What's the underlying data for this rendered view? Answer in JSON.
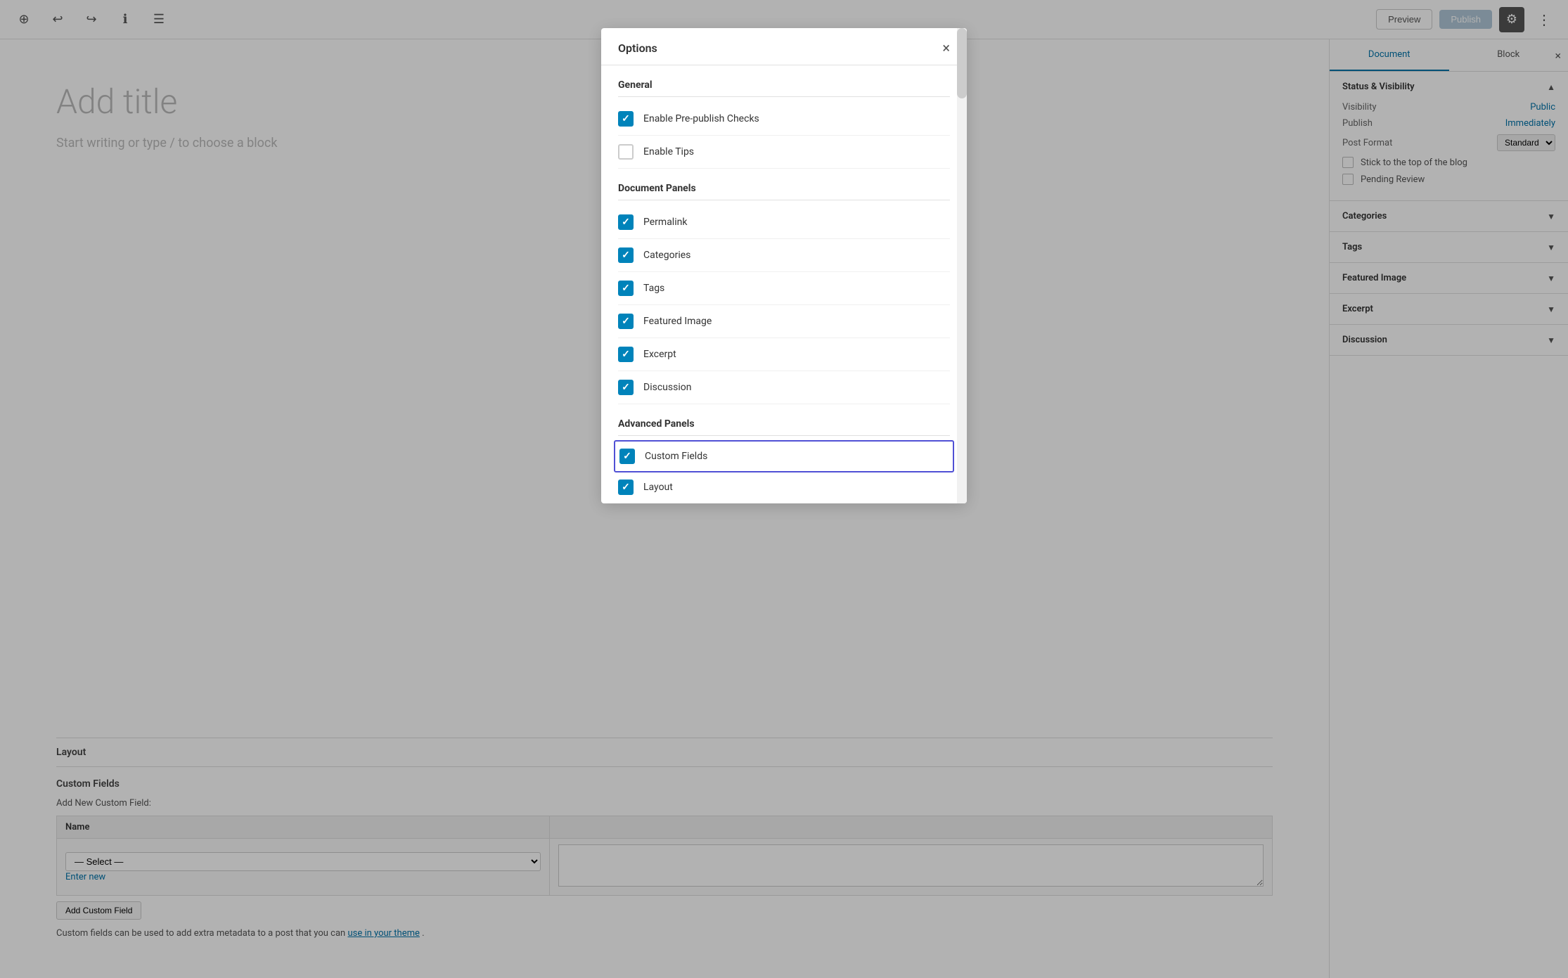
{
  "toolbar": {
    "preview_label": "Preview",
    "publish_label": "Publish",
    "add_icon": "⊕",
    "undo_icon": "↩",
    "redo_icon": "↪",
    "info_icon": "ℹ",
    "menu_icon": "☰",
    "gear_icon": "⚙",
    "dots_icon": "⋮"
  },
  "editor": {
    "title_placeholder": "Add title",
    "subtitle_placeholder": "Start writing or type / to choose a block"
  },
  "layout_section": {
    "label": "Layout"
  },
  "custom_fields_section": {
    "label": "Custom Fields",
    "add_label": "Add New Custom Field:",
    "name_col": "Name",
    "select_placeholder": "— Select —",
    "enter_new_label": "Enter new",
    "add_button": "Add Custom Field",
    "note": "Custom fields can be used to add extra metadata to a post that you can",
    "note_link": "use in your theme",
    "note_end": "."
  },
  "sidebar": {
    "tab_document": "Document",
    "tab_block": "Block",
    "close_label": "×",
    "sections": [
      {
        "id": "status-visibility",
        "title": "Status & Visibility",
        "expanded": true,
        "fields": [
          {
            "label": "Visibility",
            "value": "Public",
            "is_link": true
          },
          {
            "label": "Publish",
            "value": "Immediately",
            "is_link": true
          },
          {
            "label": "Post Format",
            "value": "Standard",
            "is_select": true
          }
        ],
        "checkboxes": [
          {
            "label": "Stick to the top of the blog",
            "checked": false
          },
          {
            "label": "Pending Review",
            "checked": false
          }
        ]
      },
      {
        "id": "categories",
        "title": "Categories",
        "expanded": false
      },
      {
        "id": "tags",
        "title": "Tags",
        "expanded": false
      },
      {
        "id": "featured-image",
        "title": "Featured Image",
        "expanded": false
      },
      {
        "id": "excerpt",
        "title": "Excerpt",
        "expanded": false
      },
      {
        "id": "discussion",
        "title": "Discussion",
        "expanded": false
      }
    ]
  },
  "modal": {
    "title": "Options",
    "close_label": "×",
    "general_title": "General",
    "general_items": [
      {
        "id": "pre-publish-checks",
        "label": "Enable Pre-publish Checks",
        "checked": true
      },
      {
        "id": "tips",
        "label": "Enable Tips",
        "checked": false
      }
    ],
    "document_panels_title": "Document Panels",
    "document_panel_items": [
      {
        "id": "permalink",
        "label": "Permalink",
        "checked": true
      },
      {
        "id": "categories",
        "label": "Categories",
        "checked": true
      },
      {
        "id": "tags",
        "label": "Tags",
        "checked": true
      },
      {
        "id": "featured-image",
        "label": "Featured Image",
        "checked": true
      },
      {
        "id": "excerpt",
        "label": "Excerpt",
        "checked": true
      },
      {
        "id": "discussion",
        "label": "Discussion",
        "checked": true
      }
    ],
    "advanced_panels_title": "Advanced Panels",
    "advanced_panel_items": [
      {
        "id": "custom-fields",
        "label": "Custom Fields",
        "checked": true,
        "highlighted": true
      },
      {
        "id": "layout",
        "label": "Layout",
        "checked": true,
        "highlighted": false
      }
    ]
  }
}
